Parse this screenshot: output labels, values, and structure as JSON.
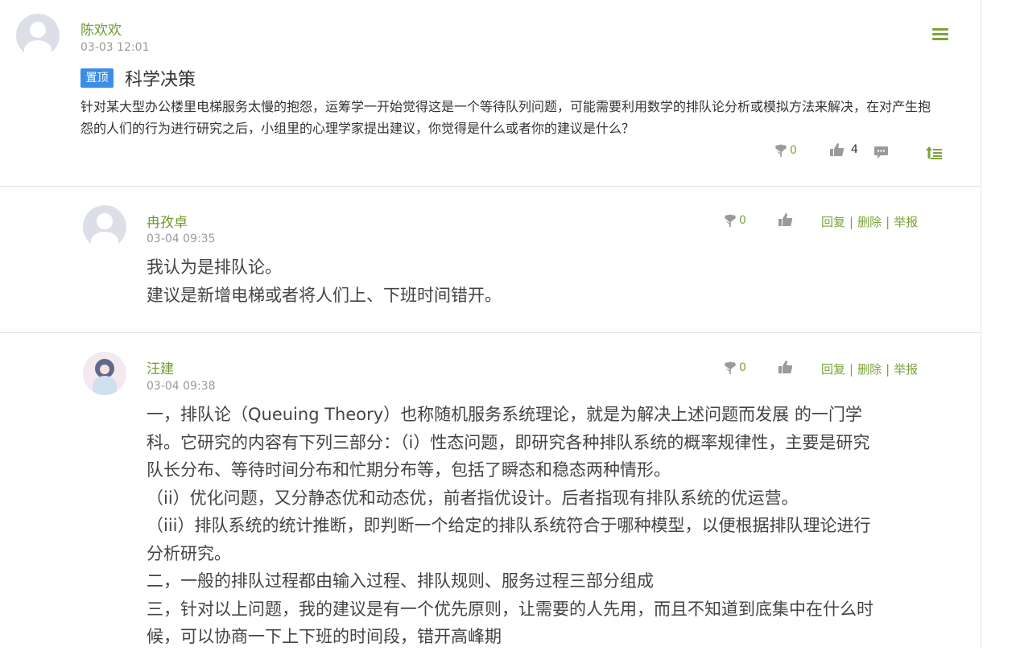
{
  "post": {
    "author": "陈欢欢",
    "time": "03-03 12:01",
    "badge": "置顶",
    "title": "科学决策",
    "body": "针对某大型办公楼里电梯服务太慢的抱怨，运筹学一开始觉得这是一个等待队列问题，可能需要利用数学的排队论分析或模拟方法来解决，在对产生抱怨的人们的行为进行研究之后，小组里的心理学家提出建议，你觉得是什么或者你的建议是什么？",
    "flower_count": "0",
    "like_count": "4"
  },
  "replies": [
    {
      "author": "冉孜卓",
      "time": "03-04 09:35",
      "flower_count": "0",
      "reply": "回复",
      "delete": "删除",
      "report": "举报",
      "lines": [
        "我认为是排队论。",
        "建议是新增电梯或者将人们上、下班时间错开。"
      ]
    },
    {
      "author": "汪建",
      "time": "03-04 09:38",
      "flower_count": "0",
      "reply": "回复",
      "delete": "删除",
      "report": "举报",
      "lines": [
        "一，排队论（Queuing Theory）也称随机服务系统理论，就是为解决上述问题而发展 的一门学",
        "科。它研究的内容有下列三部分：（i）性态问题，即研究各种排队系统的概率规律性，主要是研究",
        "队长分布、等待时间分布和忙期分布等，包括了瞬态和稳态两种情形。",
        "（ii）优化问题，又分静态优和动态优，前者指优设计。后者指现有排队系统的优运营。",
        "（iii）排队系统的统计推断，即判断一个给定的排队系统符合于哪种模型，以便根据排队理论进行",
        "分析研究。",
        "二，一般的排队过程都由输入过程、排队规则、服务过程三部分组成",
        "三，针对以上问题，我的建议是有一个优先原则，让需要的人先用，而且不知道到底集中在什么时",
        "候，可以协商一下上下班的时间段，错开高峰期"
      ]
    }
  ],
  "colors": {
    "accent": "#7ba33a",
    "badge": "#3a8ee6",
    "icon_gray": "#9a9a9a"
  },
  "icons": [
    "menu-icon",
    "flower-icon",
    "thumbs-up-icon",
    "comment-icon",
    "pin-top-icon"
  ]
}
